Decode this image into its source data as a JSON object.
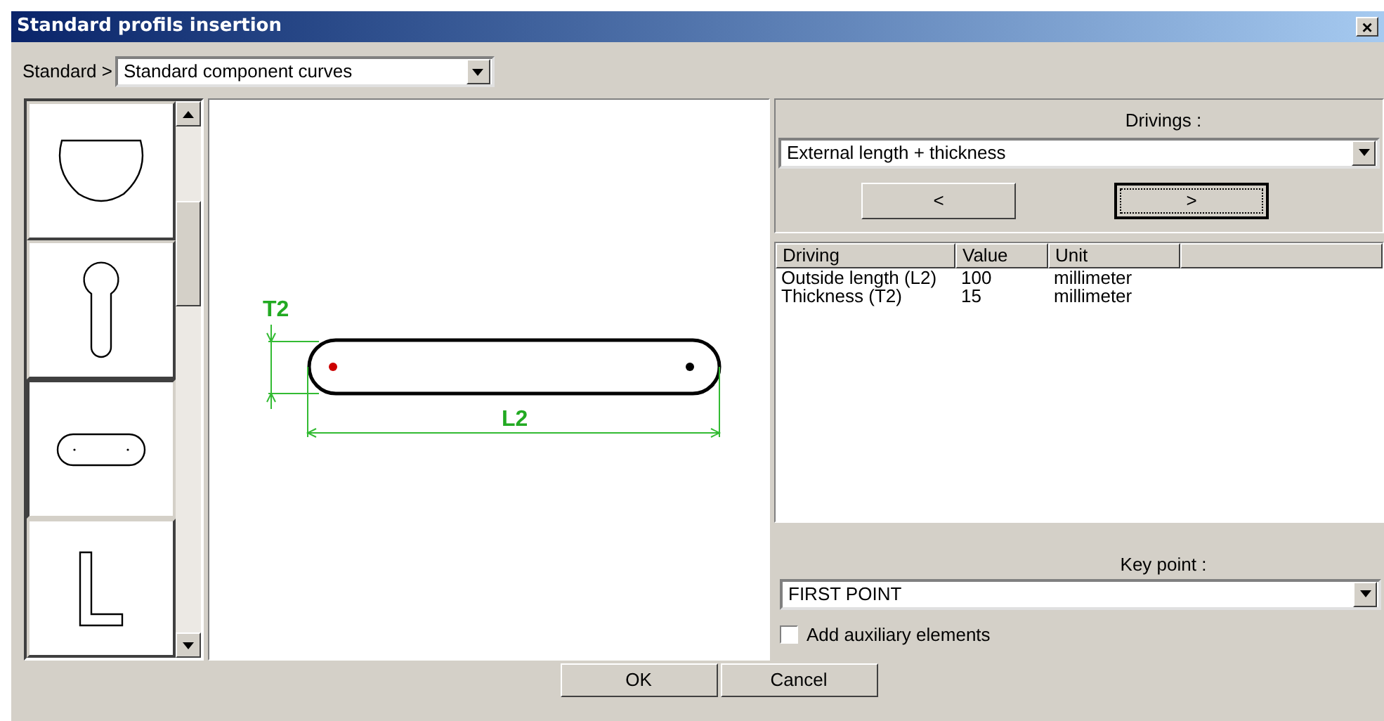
{
  "window": {
    "title": "Standard profils insertion",
    "close": "×"
  },
  "standard": {
    "label": "Standard >",
    "value": "Standard component curves"
  },
  "thumbnails": [
    {
      "kind": "half-disc",
      "selected": false
    },
    {
      "kind": "keyhole",
      "selected": false
    },
    {
      "kind": "slot",
      "selected": true
    },
    {
      "kind": "angle",
      "selected": false
    }
  ],
  "preview": {
    "labels": [
      {
        "kind": "thickness",
        "text": "T2"
      },
      {
        "kind": "length",
        "text": "L2"
      }
    ]
  },
  "drivings": {
    "label": "Drivings :",
    "value": "External length + thickness",
    "prev": "<",
    "next": ">"
  },
  "table": {
    "columns": [
      "Driving",
      "Value",
      "Unit"
    ],
    "rows": [
      {
        "cells": [
          "Outside length (L2)",
          "100",
          "millimeter"
        ]
      },
      {
        "cells": [
          "Thickness (T2)",
          "15",
          "millimeter"
        ]
      }
    ]
  },
  "key_point": {
    "label": "Key point :",
    "value": "FIRST POINT"
  },
  "auxiliary": {
    "label": "Add auxiliary elements",
    "checked": false
  },
  "buttons": [
    "OK",
    "Cancel"
  ]
}
